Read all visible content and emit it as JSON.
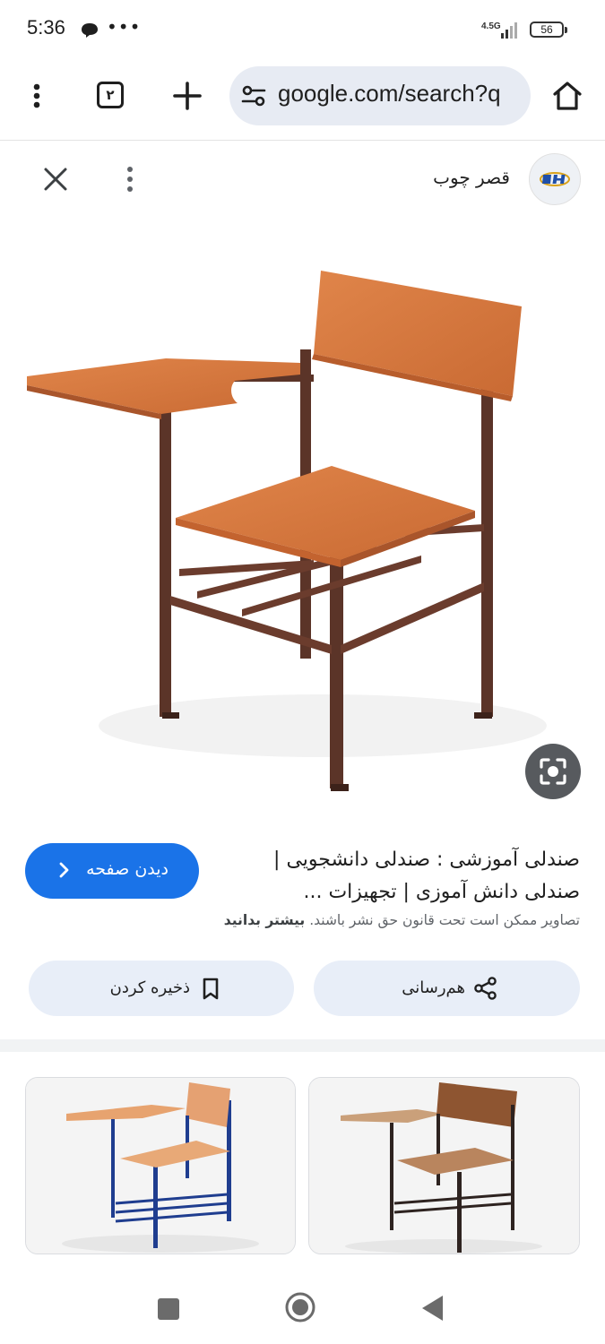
{
  "status_bar": {
    "time": "5:36",
    "network": "4.5G",
    "battery": "56"
  },
  "browser": {
    "tab_count": "۲",
    "url": "google.com/search?q"
  },
  "source": {
    "name": "قصر چوب"
  },
  "result": {
    "title": "صندلی آموزشی : صندلی دانشجویی | صندلی دانش آموزی | تجهیزات ...",
    "visit_label": "دیدن صفحه",
    "copyright_text": "تصاویر ممکن است تحت قانون حق نشر باشند.",
    "learn_more": "بیشتر بدانید"
  },
  "actions": {
    "save_label": "ذخیره کردن",
    "share_label": "هم‌رسانی"
  },
  "colors": {
    "accent": "#1a73e8",
    "pill_bg": "#e8eef8",
    "url_bar_bg": "#e7ebf3"
  },
  "icons": {
    "menu": "more-vert-icon",
    "home": "home-icon",
    "close": "close-icon",
    "lens": "google-lens-icon",
    "save": "bookmark-icon",
    "share": "share-icon"
  }
}
